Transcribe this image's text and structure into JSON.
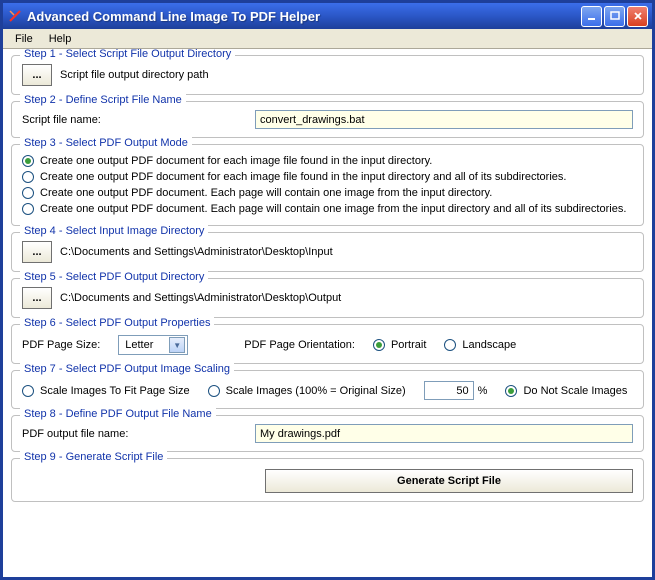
{
  "title": "Advanced Command Line Image To PDF Helper",
  "menu": {
    "file": "File",
    "help": "Help"
  },
  "step1": {
    "legend": "Step 1 - Select Script File Output Directory",
    "browse": "...",
    "path": "Script file output directory path"
  },
  "step2": {
    "legend": "Step 2 - Define Script File Name",
    "label": "Script file name:",
    "value": "convert_drawings.bat"
  },
  "step3": {
    "legend": "Step 3 - Select PDF Output Mode",
    "opt1": "Create one output PDF document for each image file found in the input directory.",
    "opt2": "Create one output PDF document for each image file found in the input directory and all of its subdirectories.",
    "opt3": "Create one output PDF document. Each page will contain one image from the input directory.",
    "opt4": "Create one output PDF document. Each page will contain one image from the input directory and all of its subdirectories.",
    "selected": 1
  },
  "step4": {
    "legend": "Step 4 - Select Input Image Directory",
    "browse": "...",
    "path": "C:\\Documents and Settings\\Administrator\\Desktop\\Input"
  },
  "step5": {
    "legend": "Step 5 - Select PDF Output Directory",
    "browse": "...",
    "path": "C:\\Documents and Settings\\Administrator\\Desktop\\Output"
  },
  "step6": {
    "legend": "Step 6 - Select PDF Output Properties",
    "page_size_label": "PDF Page Size:",
    "page_size_value": "Letter",
    "orientation_label": "PDF Page Orientation:",
    "portrait": "Portrait",
    "landscape": "Landscape",
    "orientation_selected": "portrait"
  },
  "step7": {
    "legend": "Step 7 - Select PDF Output Image Scaling",
    "opt_fit": "Scale Images To Fit Page Size",
    "opt_percent": "Scale Images (100% = Original Size)",
    "percent_value": "50",
    "percent_suffix": "%",
    "opt_none": "Do Not Scale Images",
    "selected": "none"
  },
  "step8": {
    "legend": "Step 8 - Define PDF Output File Name",
    "label": "PDF output file name:",
    "value": "My drawings.pdf"
  },
  "step9": {
    "legend": "Step 9 - Generate Script File",
    "button": "Generate Script File"
  }
}
